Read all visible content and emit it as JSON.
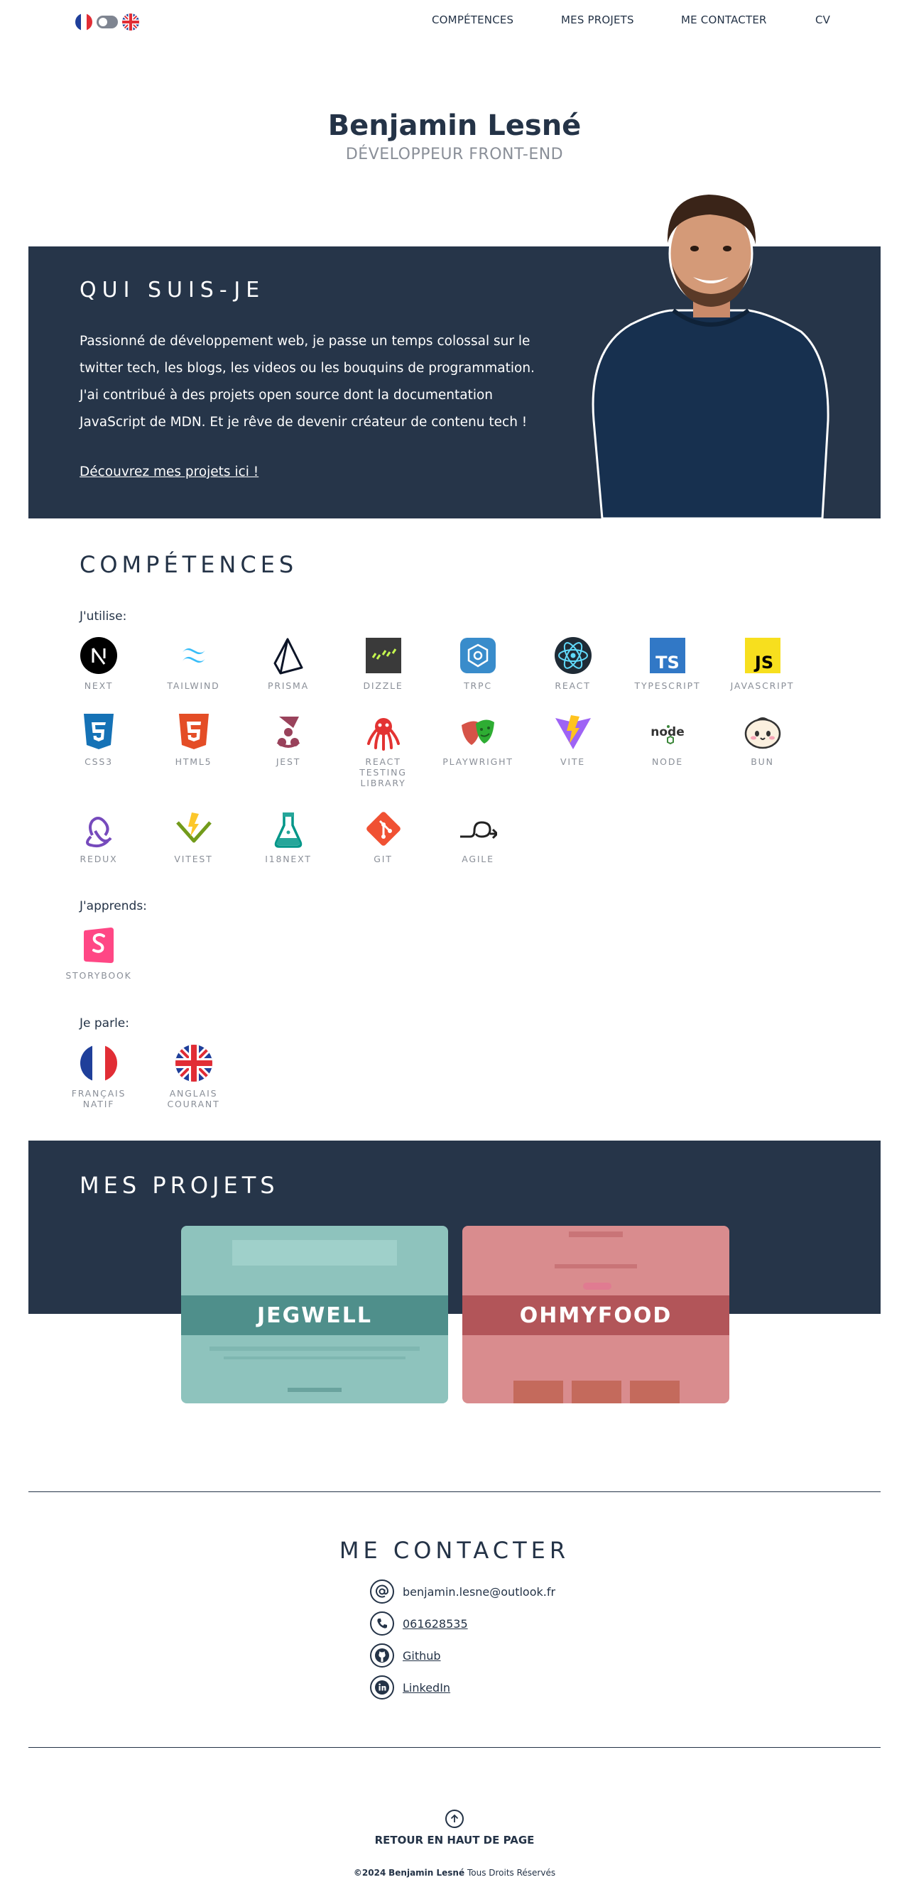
{
  "header": {
    "lang_fr": "fr-flag-icon",
    "lang_en": "uk-flag-icon",
    "nav": [
      "COMPÉTENCES",
      "MES PROJETS",
      "ME CONTACTER",
      "CV"
    ]
  },
  "hero": {
    "name": "Benjamin Lesné",
    "role": "DÉVELOPPEUR FRONT-END"
  },
  "about": {
    "title": "QUI SUIS-JE",
    "text": "Passionné de développement web, je passe un temps colossal sur le twitter tech, les blogs, les videos ou les bouquins de programmation. J'ai contribué à des projets open source dont la documentation JavaScript de MDN. Et je rêve de devenir créateur de contenu tech !",
    "link": "Découvrez mes projets ici !"
  },
  "skills": {
    "title": "COMPÉTENCES",
    "uses_label": "J'utilise:",
    "uses": [
      {
        "label": "NEXT",
        "icon": "next-icon"
      },
      {
        "label": "TAILWIND",
        "icon": "tailwind-icon"
      },
      {
        "label": "PRISMA",
        "icon": "prisma-icon"
      },
      {
        "label": "DIZZLE",
        "icon": "drizzle-icon"
      },
      {
        "label": "TRPC",
        "icon": "trpc-icon"
      },
      {
        "label": "REACT",
        "icon": "react-icon"
      },
      {
        "label": "TYPESCRIPT",
        "icon": "typescript-icon"
      },
      {
        "label": "JAVASCRIPT",
        "icon": "javascript-icon"
      },
      {
        "label": "CSS3",
        "icon": "css3-icon"
      },
      {
        "label": "HTML5",
        "icon": "html5-icon"
      },
      {
        "label": "JEST",
        "icon": "jest-icon"
      },
      {
        "label": "REACT TESTING LIBRARY",
        "icon": "testing-library-icon"
      },
      {
        "label": "PLAYWRIGHT",
        "icon": "playwright-icon"
      },
      {
        "label": "VITE",
        "icon": "vite-icon"
      },
      {
        "label": "NODE",
        "icon": "node-icon"
      },
      {
        "label": "BUN",
        "icon": "bun-icon"
      },
      {
        "label": "REDUX",
        "icon": "redux-icon"
      },
      {
        "label": "VITEST",
        "icon": "vitest-icon"
      },
      {
        "label": "I18NEXT",
        "icon": "i18next-icon"
      },
      {
        "label": "GIT",
        "icon": "git-icon"
      },
      {
        "label": "AGILE",
        "icon": "agile-icon"
      }
    ],
    "learning_label": "J'apprends:",
    "learning": [
      {
        "label": "STORYBOOK",
        "icon": "storybook-icon"
      }
    ],
    "speaks_label": "Je parle:",
    "speaks": [
      {
        "label": "FRANÇAIS NATIF",
        "icon": "fr-flag-icon"
      },
      {
        "label": "ANGLAIS COURANT",
        "icon": "uk-flag-icon"
      }
    ]
  },
  "projects": {
    "title": "MES PROJETS",
    "cards": [
      {
        "title": "JEGWELL",
        "color": "#4f8f8b"
      },
      {
        "title": "OHMYFOOD",
        "color": "#b25559"
      }
    ]
  },
  "contact": {
    "title": "ME CONTACTER",
    "email": "benjamin.lesne@outlook.fr",
    "phone": "061628535",
    "github": "Github",
    "linkedin": "LinkedIn"
  },
  "footer": {
    "back_top": "RETOUR EN HAUT DE PAGE",
    "copyright_year": "©2024",
    "copyright_name": "Benjamin Lesné",
    "copyright_rest": "Tous Droits Réservés"
  },
  "colors": {
    "navy": "#263549",
    "text": "#243347",
    "muted": "#8a8f98"
  }
}
